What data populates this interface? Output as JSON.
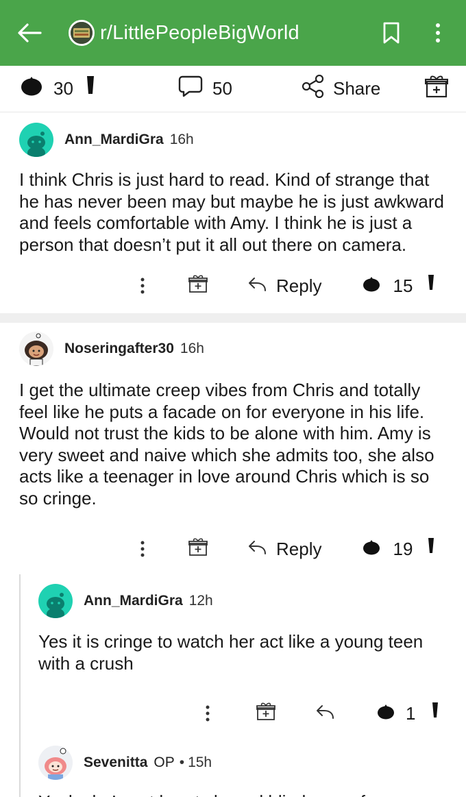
{
  "topbar": {
    "subreddit": "r/LittlePeopleBigWorld",
    "icons": [
      "back-arrow-icon",
      "subreddit-avatar",
      "bookmark-icon",
      "more-vertical-icon"
    ]
  },
  "post_actions": {
    "votes": "30",
    "comments": "50",
    "share_label": "Share"
  },
  "comments": [
    {
      "author": "Ann_MardiGra",
      "age": "16h",
      "body": "I think Chris is just hard to read. Kind of strange that he has never been may but maybe he is just awkward and feels comfortable with Amy. I think he is just a person that doesn’t put it all out there on camera.",
      "reply_label": "Reply",
      "votes": "15"
    },
    {
      "author": "Noseringafter30",
      "age": "16h",
      "body": "I get the ultimate creep vibes from Chris and totally feel like he puts a facade on for everyone in his life. Would not trust the kids to be alone with him. Amy is very sweet and naive which she admits too, she also acts like a teenager in love around Chris which is so so cringe.",
      "reply_label": "Reply",
      "votes": "19"
    },
    {
      "author": "Ann_MardiGra",
      "age": "12h",
      "body": "Yes it is cringe to watch her act like a young teen with a crush",
      "votes": "1"
    },
    {
      "author": "Sevenitta",
      "op_badge": "OP",
      "separator": "•",
      "age": "15h",
      "body": "Yeah she’s got heart shaped blinders on for sure."
    }
  ],
  "colors": {
    "topbar": "#4aa54a",
    "avatar_teal": "#1fd1b2",
    "divider": "#efefef"
  }
}
